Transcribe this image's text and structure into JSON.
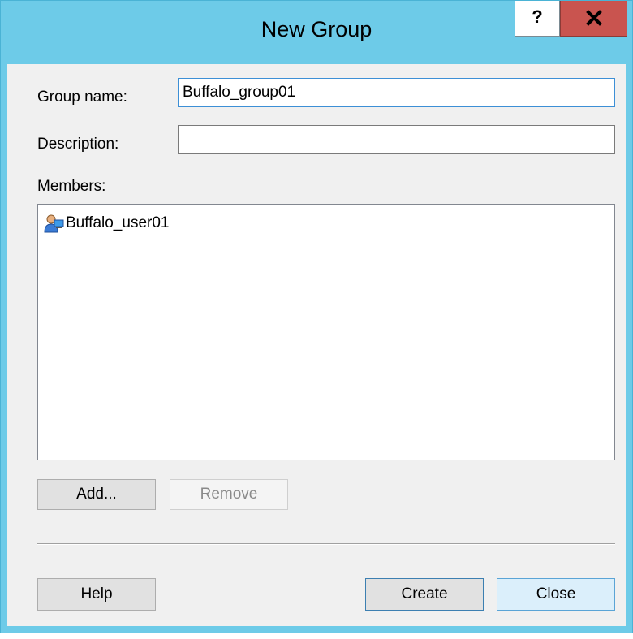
{
  "window": {
    "title": "New Group",
    "help_glyph": "?",
    "close_icon": "close-icon"
  },
  "form": {
    "group_name_label": "Group name:",
    "group_name_value": "Buffalo_group01",
    "description_label": "Description:",
    "description_value": "",
    "members_label": "Members:"
  },
  "members": [
    {
      "name": "Buffalo_user01",
      "icon": "user-account-icon"
    }
  ],
  "buttons": {
    "add": "Add...",
    "remove": "Remove",
    "help": "Help",
    "create": "Create",
    "close": "Close"
  },
  "colors": {
    "titlebar": "#6dcbe8",
    "close_button": "#c9544f",
    "client_bg": "#f0f0f0"
  }
}
